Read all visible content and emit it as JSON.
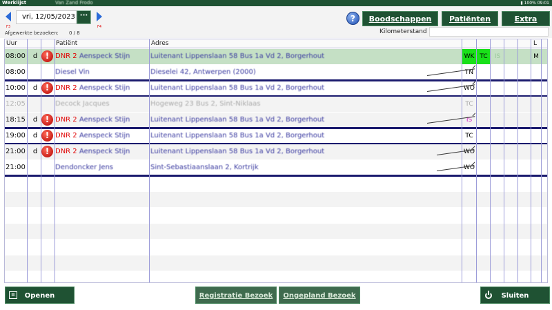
{
  "window": {
    "title": "Werklijst",
    "user": "Van Zand Frodo",
    "battery": "100%",
    "clock": "09:01"
  },
  "toolbar": {
    "date": "vri, 12/05/2023",
    "date_button": "···",
    "prev_key": "F3",
    "next_key": "F4",
    "help": "?",
    "boodschappen": "Boodschappen",
    "patienten": "Patiënten",
    "extra": "Extra",
    "visits_label": "Afgewerkte bezoeken:",
    "visits_count": "0 /  8",
    "km_label": "Kilometerstand",
    "km_value": ""
  },
  "table": {
    "headers": {
      "uur": "Uur",
      "patient": "Patiënt",
      "adres": "Adres",
      "l": "L"
    },
    "rows": [
      {
        "time": "08:00",
        "d": "d",
        "warn": "!",
        "dnr": "DNR 2",
        "name": "Aenspeck Stijn",
        "address": "Luitenant Lippenslaan 58 Bus 1a Vd 2, Borgerhout",
        "c1": "WK",
        "c2": "TC",
        "c3": "IS",
        "l": "M"
      },
      {
        "time": "08:00",
        "d": "",
        "warn": "",
        "dnr": "",
        "name": "Diesel Vin",
        "address": "Dieselei 42, Antwerpen (2000)",
        "c1": "TN",
        "c2": "",
        "c3": "",
        "l": ""
      },
      {
        "time": "10:00",
        "d": "d",
        "warn": "!",
        "dnr": "DNR 2",
        "name": "Aenspeck Stijn",
        "address": "Luitenant Lippenslaan 58 Bus 1a Vd 2, Borgerhout",
        "c1": "WO",
        "c2": "",
        "c3": "",
        "l": ""
      },
      {
        "time": "12:05",
        "d": "",
        "warn": "",
        "dnr": "",
        "name": "Decock Jacques",
        "address": "Hogeweg 23 Bus 2, Sint-Niklaas",
        "c1": "TC",
        "c2": "",
        "c3": "",
        "l": ""
      },
      {
        "time": "18:15",
        "d": "d",
        "warn": "!",
        "dnr": "DNR 2",
        "name": "Aenspeck Stijn",
        "address": "Luitenant Lippenslaan 58 Bus 1a Vd 2, Borgerhout",
        "c1": "IS",
        "c2": "",
        "c3": "",
        "l": ""
      },
      {
        "time": "19:00",
        "d": "d",
        "warn": "!",
        "dnr": "DNR 2",
        "name": "Aenspeck Stijn",
        "address": "Luitenant Lippenslaan 58 Bus 1a Vd 2, Borgerhout",
        "c1": "TC",
        "c2": "",
        "c3": "",
        "l": ""
      },
      {
        "time": "21:00",
        "d": "d",
        "warn": "!",
        "dnr": "DNR 2",
        "name": "Aenspeck Stijn",
        "address": "Luitenant Lippenslaan 58 Bus 1a Vd 2, Borgerhout",
        "c1": "WO",
        "c2": "",
        "c3": "",
        "l": ""
      },
      {
        "time": "21:00",
        "d": "",
        "warn": "",
        "dnr": "",
        "name": "Dendoncker Jens",
        "address": "Sint-Sebastiaanslaan 2, Kortrijk",
        "c1": "WO",
        "c2": "",
        "c3": "",
        "l": ""
      }
    ]
  },
  "bottom": {
    "openen": "Openen",
    "registratie": "Registratie Bezoek",
    "ongepland": "Ongepland Bezoek",
    "sluiten": "Sluiten"
  },
  "colors": {
    "brand_green": "#1f5233",
    "highlight_row": "#c5e0c5",
    "status_green": "#19e019",
    "dnr_red": "#e00000",
    "patient_blue": "#3a3aa0"
  }
}
